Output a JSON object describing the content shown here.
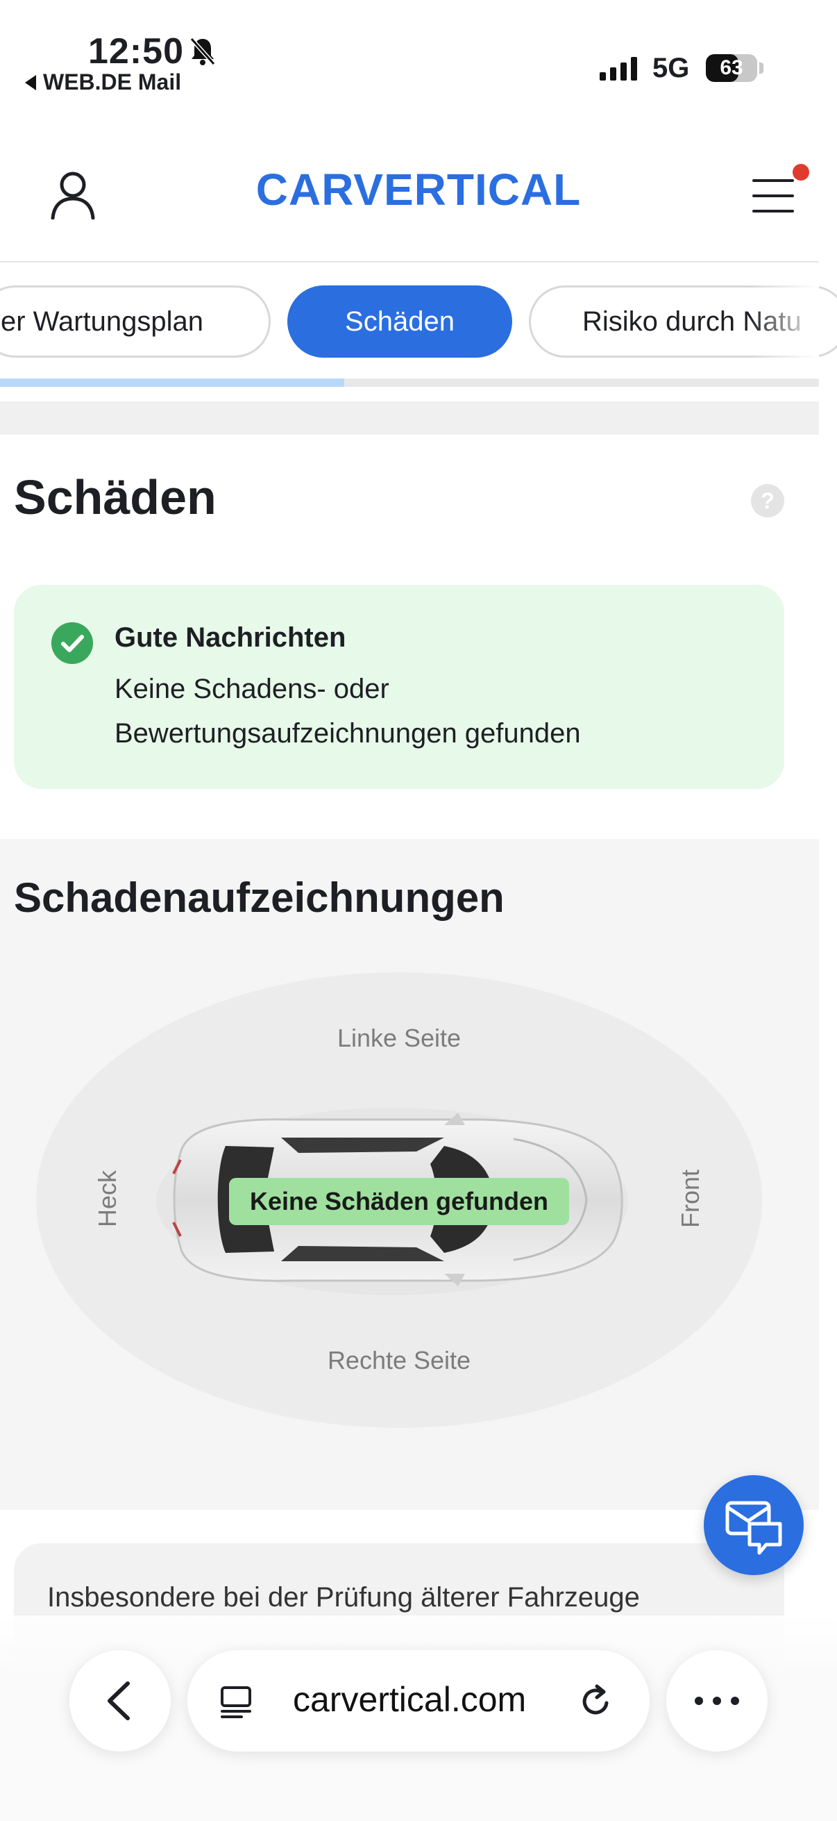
{
  "status_bar": {
    "time": "12:50",
    "back_app": "WEB.DE Mail",
    "network": "5G",
    "battery": "63",
    "battery_level": 0.63
  },
  "header": {
    "logo": "CARVERTICAL",
    "user_icon": "user-icon",
    "menu_icon": "hamburger-menu-icon",
    "notification_color": "#e03a2f"
  },
  "tabs": [
    {
      "label": "er Wartungsplan",
      "active": false
    },
    {
      "label": "Schäden",
      "active": true
    },
    {
      "label": "Risiko durch Natu",
      "active": false
    }
  ],
  "tabs_progress": 0.42,
  "section": {
    "title": "Schäden",
    "help_icon": "?"
  },
  "good_news": {
    "title": "Gute Nachrichten",
    "text": "Keine Schadens- oder Bewertungsaufzeichnungen gefunden"
  },
  "records": {
    "title": "Schadenaufzeichnungen",
    "left_side": "Linke Seite",
    "right_side": "Rechte Seite",
    "rear": "Heck",
    "front": "Front",
    "badge": "Keine Schäden gefunden"
  },
  "info": {
    "text": "Insbesondere bei der Prüfung älterer Fahrzeuge"
  },
  "browser": {
    "url": "carvertical.com"
  },
  "colors": {
    "accent": "#2a6ee0",
    "success_bg": "#e7f9e9",
    "success_icon": "#3aa85c",
    "badge_bg": "#9fe09f"
  }
}
